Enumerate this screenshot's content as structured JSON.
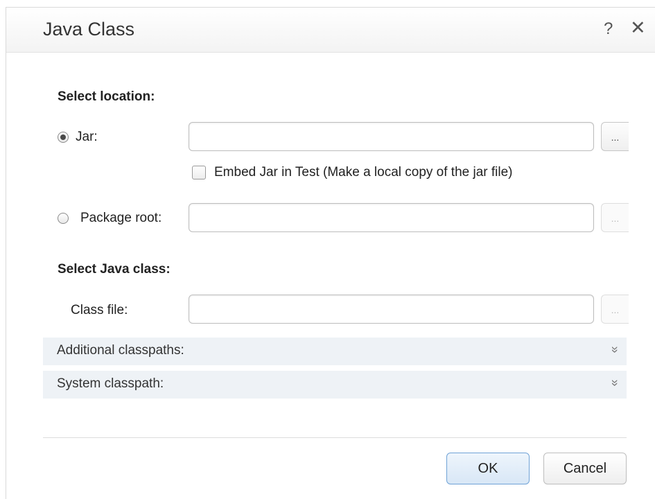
{
  "dialog": {
    "title": "Java Class",
    "help_label": "?",
    "close_label": "✕"
  },
  "location": {
    "heading": "Select location:",
    "jar": {
      "label": "Jar:",
      "selected": true,
      "value": "",
      "browse_label": "..."
    },
    "embed": {
      "label": "Embed Jar in Test (Make a local copy of the jar file)",
      "checked": false
    },
    "package_root": {
      "label": "Package root:",
      "selected": false,
      "value": "",
      "browse_label": "..."
    }
  },
  "java_class": {
    "heading": "Select Java class:",
    "class_file": {
      "label": "Class file:",
      "value": "",
      "browse_label": "..."
    }
  },
  "sections": {
    "additional": {
      "label": "Additional classpaths:",
      "icon": "double-chevron-down-icon",
      "glyph": "»"
    },
    "system": {
      "label": "System classpath:",
      "icon": "double-chevron-down-icon",
      "glyph": "»"
    }
  },
  "buttons": {
    "ok": "OK",
    "cancel": "Cancel"
  },
  "colors": {
    "accent_border": "#6fa2d6",
    "section_bg": "#eef2f6"
  }
}
